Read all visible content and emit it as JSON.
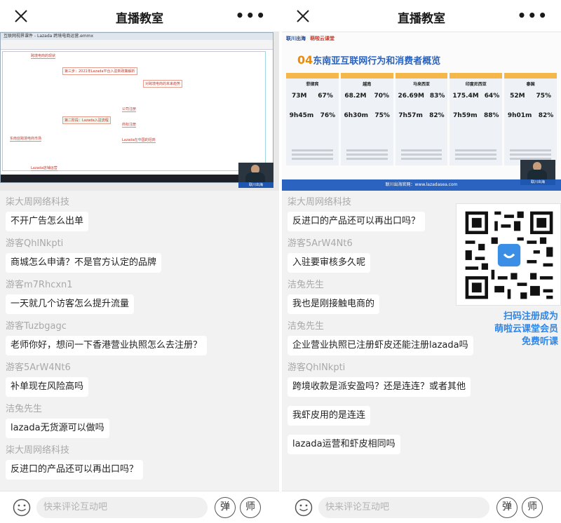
{
  "left": {
    "title": "直播教室",
    "video": {
      "window_title": "互联网视界课件 - Lazada 跨境电商运营.emmx",
      "nodes": [
        "跨境电商的现状",
        "第三步：2021年Lazada平台入驻新政策解析",
        "对跨境电商的未来趋势",
        "第二阶段：Lazada入驻流程",
        "公司注册",
        "商标注册",
        "Lazada在中国的招商",
        "东南亚跨境电商市场",
        "Lazada店铺运营"
      ],
      "presenter_logo": "联川出海"
    },
    "messages": [
      {
        "user": "柒大周网络科技",
        "text": "不开广告怎么出单"
      },
      {
        "user": "游客QhlNkpti",
        "text": "商城怎么申请？不是官方认定的品牌"
      },
      {
        "user": "游客m7Rhcxn1",
        "text": "一天就几个访客怎么提升流量"
      },
      {
        "user": "游客Tuzbgagc",
        "text": "老师你好，想问一下香港营业执照怎么去注册？"
      },
      {
        "user": "游客5ArW4Nt6",
        "text": "补单现在风险高吗"
      },
      {
        "user": "洁兔先生",
        "text": "lazada无货源可以做吗"
      },
      {
        "user": "柒大周网络科技",
        "text": "反进口的产品还可以再出口吗？"
      }
    ],
    "input_placeholder": "快来评论互动吧",
    "danmu_label": "弹",
    "teacher_label": "师"
  },
  "right": {
    "title": "直播教室",
    "video": {
      "logo1": "联川出海",
      "logo2": "萌啦云课堂",
      "headline_num": "04",
      "headline": "东南亚互联网行为和消费者概览",
      "countries": [
        {
          "name": "菲律宾",
          "a": "73M",
          "b": "67%",
          "c": "9h45m",
          "d": "76%"
        },
        {
          "name": "越南",
          "a": "68.2M",
          "b": "70%",
          "c": "6h30m",
          "d": "75%"
        },
        {
          "name": "马来西亚",
          "a": "26.69M",
          "b": "83%",
          "c": "7h57m",
          "d": "82%"
        },
        {
          "name": "印度尼西亚",
          "a": "175.4M",
          "b": "64%",
          "c": "7h59m",
          "d": "88%"
        },
        {
          "name": "泰国",
          "a": "52M",
          "b": "75%",
          "c": "9h01m",
          "d": "82%"
        }
      ],
      "footer": "联川出海官网：www.lazadasea.com",
      "presenter_logo": "联川出海"
    },
    "messages": [
      {
        "user": "柒大周网络科技",
        "text": "反进口的产品还可以再出口吗？"
      },
      {
        "user": "游客5ArW4Nt6",
        "text": "入驻要审核多久呢"
      },
      {
        "user": "洁兔先生",
        "text": "我也是刚接触电商的"
      },
      {
        "user": "洁兔先生",
        "text": "企业营业执照已注册虾皮还能注册lazada吗"
      },
      {
        "user": "游客QhlNkpti",
        "text": "跨境收款是派安盈吗？还是连连？或者其他"
      },
      {
        "user": "",
        "text": "我虾皮用的是连连"
      },
      {
        "user": "",
        "text": "lazada运营和虾皮相同吗"
      }
    ],
    "promo": [
      "扫码注册成为",
      "萌啦云课堂会员",
      "免费听课"
    ],
    "input_placeholder": "快来评论互动吧",
    "danmu_label": "弹",
    "teacher_label": "师"
  },
  "colors": {
    "accent": "#2f86e8",
    "bubble": "#ffffff",
    "chat_bg": "#f2f2f2",
    "username": "#a9a9a9"
  },
  "icons": [
    "close-icon",
    "more-icon",
    "emoji-icon",
    "qr-code-icon"
  ]
}
